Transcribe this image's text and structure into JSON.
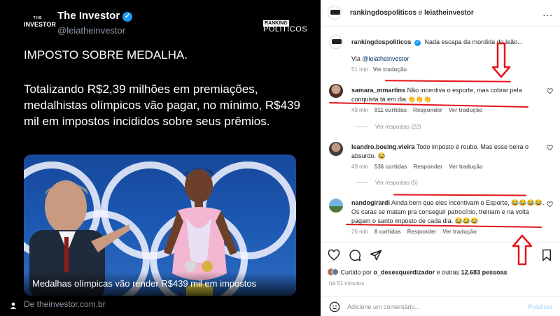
{
  "left": {
    "brand_logo_small": "THE",
    "brand_logo_big": "INVESTOR",
    "account_name": "The Investor",
    "handle": "@leiatheinvestor",
    "ranking_logo_top": "RANKING",
    "ranking_logo_bottom": "POLÍTICOS",
    "headline": "IMPOSTO SOBRE MEDALHA.",
    "body": "Totalizando R$2,39 milhões em premiações, medalhistas olímpicos vão pagar, no mínimo, R$439 mil em impostos incididos sobre seus prêmios.",
    "image_caption": "Medalhas olímpicas vão render R$439 mil em impostos",
    "source": "De theinvestor.com.br"
  },
  "right": {
    "header": {
      "user1": "rankingdospoliticos",
      "connector": " e ",
      "user2": "leiatheinvestor",
      "more": "..."
    },
    "caption": {
      "user": "rankingdospoliticos",
      "text": "Nada escapa da mordida do leão...",
      "via": "Via ",
      "via_handle": "@leiatheinvestor",
      "time": "51 min",
      "translate": "Ver tradução"
    },
    "comments": [
      {
        "user": "samara_mmartins",
        "text": "Não incentiva o esporte, mas cobrar pela conquista tá em dia 👏👏👏",
        "time": "49 min",
        "likes": "911 curtidas",
        "reply": "Responder",
        "translate": "Ver tradução",
        "view_replies": "Ver respostas (22)"
      },
      {
        "user": "leandro.boeing.vieira",
        "text": "Todo imposto é roubo. Mas esse beira o absurdo. 😂",
        "time": "49 min",
        "likes": "536 curtidas",
        "reply": "Responder",
        "translate": "Ver tradução",
        "view_replies": "Ver respostas (5)"
      },
      {
        "user": "nandogirardi",
        "text": "Ainda bem que eles incentivam o Esporte, 😂😂😂😂. Os caras se matam pra conseguir patrocínio, treinam e na volta pagam o santo imposto de cada dia. 😂😂😂",
        "time": "26 min",
        "likes": "8 curtidas",
        "reply": "Responder",
        "translate": "Ver tradução"
      }
    ],
    "liked_by_prefix": "Curtido por ",
    "liked_by_user": "o_desesquerdizador",
    "liked_by_suffix": " e outras ",
    "liked_by_count": "12.683 pessoas",
    "time_ago": "há 51 minutos",
    "add_comment_placeholder": "Adicione um comentário...",
    "publish": "Publicar"
  },
  "colors": {
    "twitter_bg": "#000000",
    "verified_blue": "#1d9bf0",
    "annotation_red": "#e3161b",
    "ig_link": "#00376b"
  }
}
